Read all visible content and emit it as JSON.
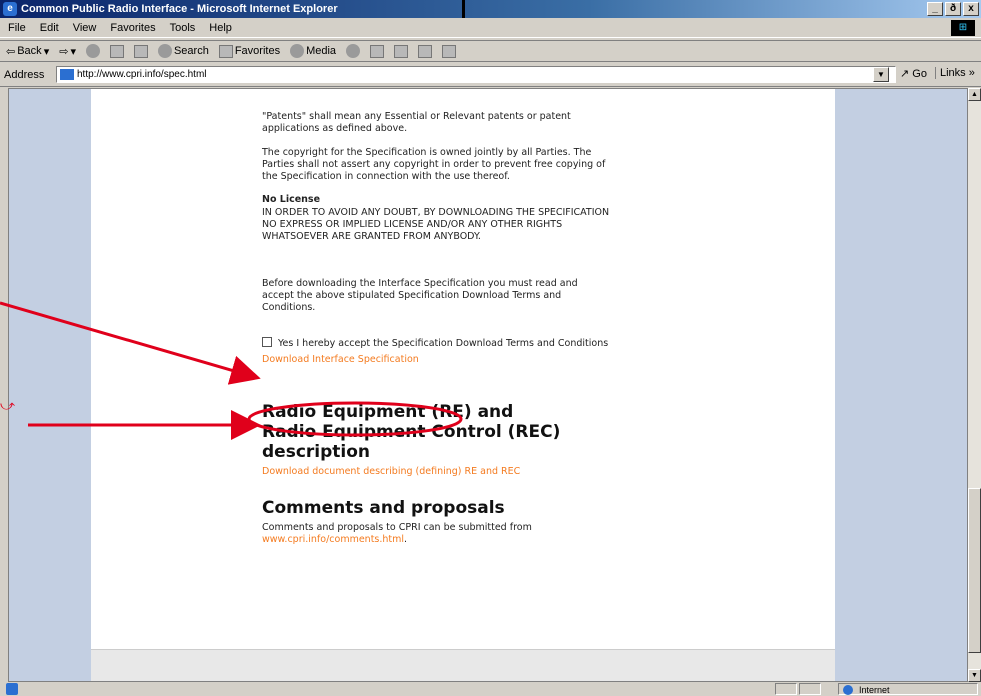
{
  "window": {
    "title": "Common Public Radio Interface - Microsoft Internet Explorer",
    "ie_icon": "ie",
    "min": "_",
    "max": "ð",
    "close": "x"
  },
  "menu": [
    "File",
    "Edit",
    "View",
    "Favorites",
    "Tools",
    "Help"
  ],
  "toolbar": {
    "back": "Back",
    "search": "Search",
    "favorites": "Favorites",
    "media": "Media"
  },
  "address": {
    "label": "Address",
    "url": "http://www.cpri.info/spec.html",
    "go": "Go",
    "links": "Links"
  },
  "content": {
    "patents": "\"Patents\" shall mean any Essential or Relevant patents or patent applications as defined above.",
    "copyright": "The copyright for the Specification is owned jointly by all Parties. The Parties shall not assert any copyright in order to prevent free copying of the Specification in connection with the use thereof.",
    "no_license_heading": "No License",
    "no_license_text": "IN ORDER TO AVOID ANY DOUBT, BY DOWNLOADING THE SPECIFICATION NO EXPRESS OR IMPLIED LICENSE AND/OR ANY OTHER RIGHTS WHATSOEVER ARE GRANTED FROM ANYBODY.",
    "before_download": "Before downloading the Interface Specification you must read and accept the above stipulated Specification Download Terms and Conditions.",
    "accept_label": "Yes I hereby accept the Specification Download Terms and Conditions",
    "download_spec_link": "Download Interface Specification",
    "re_heading_line1": "Radio Equipment (RE) and",
    "re_heading_line2": "Radio Equipment Control (REC)",
    "re_heading_line3": "description",
    "re_download_link": "Download document describing (defining) RE and REC",
    "comments_heading": "Comments and proposals",
    "comments_text": "Comments and proposals to CPRI can be submitted from",
    "comments_link": "www.cpri.info/comments.html",
    "comments_end": "."
  },
  "status": {
    "zone": "Internet"
  },
  "colors": {
    "link": "#f47b20",
    "annotation": "#e0001b",
    "slide_background": "#f5c400"
  }
}
